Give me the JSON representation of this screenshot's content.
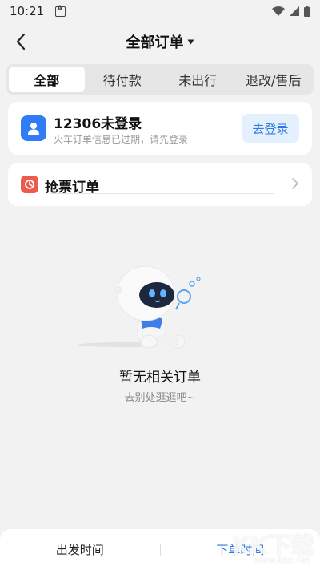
{
  "status_bar": {
    "time": "10:21"
  },
  "header": {
    "title": "全部订单",
    "back_icon": "chevron-left-icon",
    "dropdown_icon": "caret-down-icon"
  },
  "tabs": [
    {
      "label": "全部",
      "active": true
    },
    {
      "label": "待付款",
      "active": false
    },
    {
      "label": "未出行",
      "active": false
    },
    {
      "label": "退改/售后",
      "active": false
    }
  ],
  "login_card": {
    "title": "12306未登录",
    "subtitle": "火车订单信息已过期，请先登录",
    "button_label": "去登录",
    "icon": "user-icon"
  },
  "grab_card": {
    "title": "抢票订单",
    "icon": "grab-ticket-icon"
  },
  "empty_state": {
    "title": "暂无相关订单",
    "subtitle": "去别处逛逛吧~"
  },
  "bottom_bar": {
    "items": [
      {
        "label": "出发时间",
        "active": false
      },
      {
        "label": "下单时间",
        "active": true
      }
    ]
  },
  "watermark": {
    "main": "KK下载",
    "sub": "www.kkx.net"
  },
  "colors": {
    "accent": "#2b78e4",
    "background": "#f2f2f2",
    "grab_icon": "#ef5a4f"
  }
}
